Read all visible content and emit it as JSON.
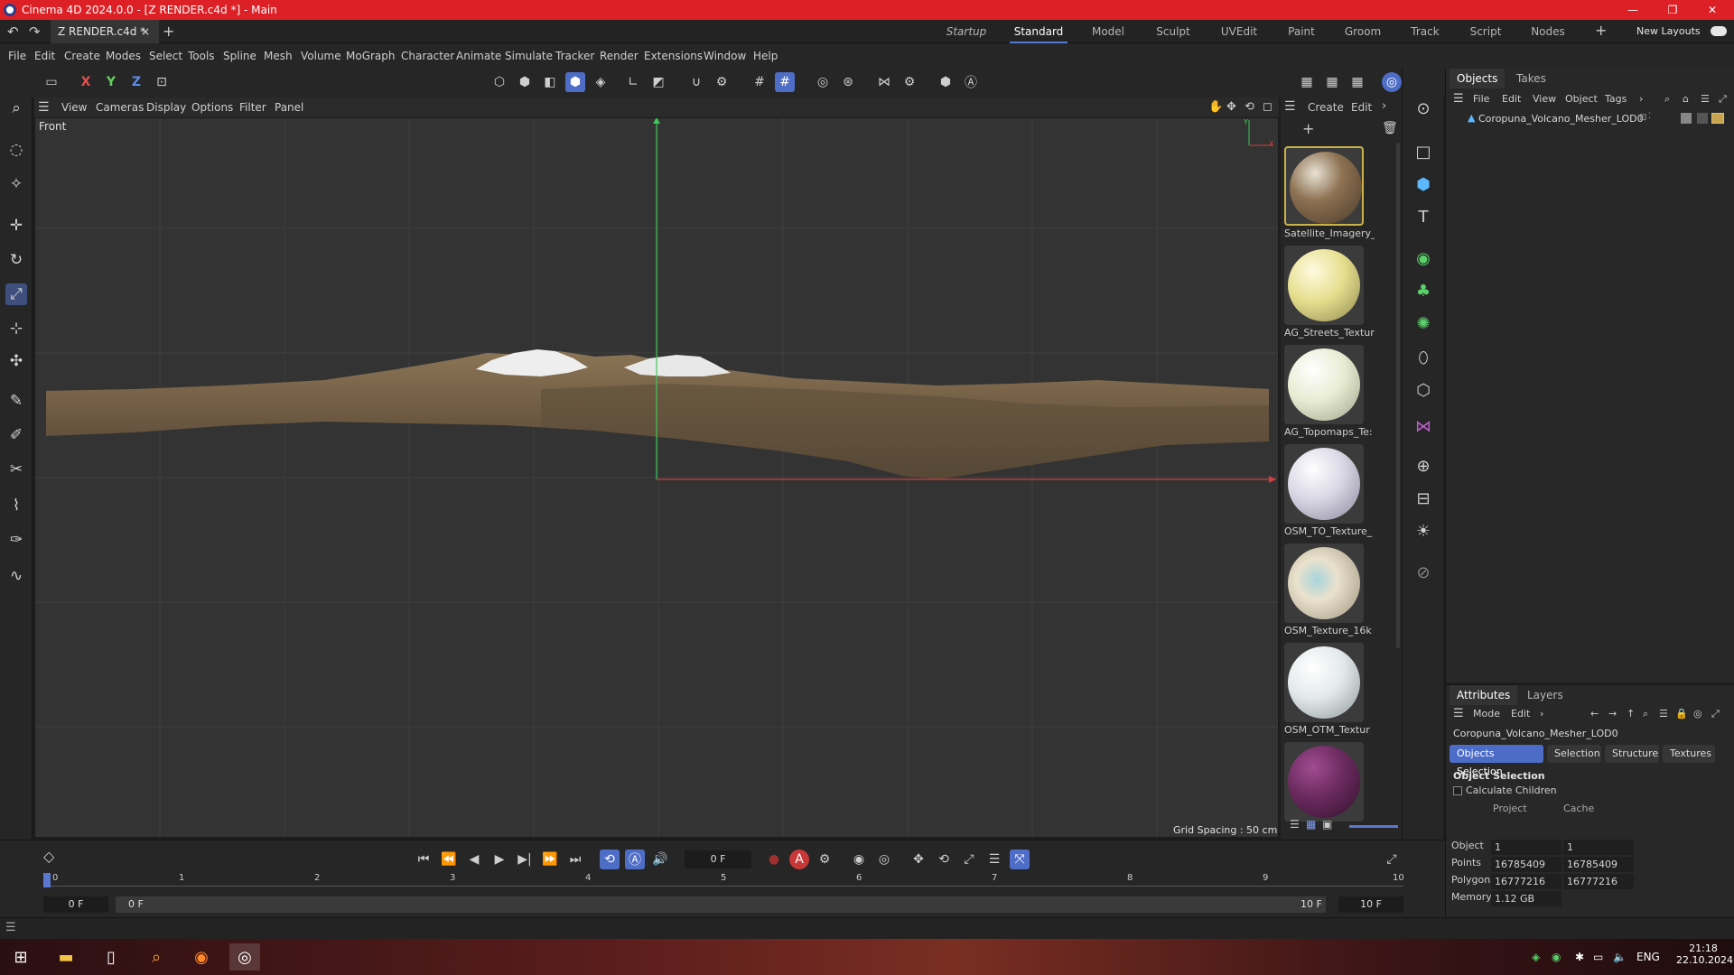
{
  "window": {
    "title": "Cinema 4D 2024.0.0 - [Z RENDER.c4d *] - Main"
  },
  "doc_tab": {
    "label": "Z RENDER.c4d *",
    "close": "×",
    "add": "+"
  },
  "layouts": {
    "items": [
      "Startup",
      "Standard",
      "Model",
      "Sculpt",
      "UVEdit",
      "Paint",
      "Groom",
      "Track",
      "Script",
      "Nodes"
    ],
    "new_layouts": "New Layouts"
  },
  "menu": [
    "File",
    "Edit",
    "Create",
    "Modes",
    "Select",
    "Tools",
    "Spline",
    "Mesh",
    "Volume",
    "MoGraph",
    "Character",
    "Animate",
    "Simulate",
    "Tracker",
    "Render",
    "Extensions",
    "Window",
    "Help"
  ],
  "axis_lock": {
    "x": "X",
    "y": "Y",
    "z": "Z"
  },
  "viewport": {
    "menu": [
      "View",
      "Cameras",
      "Display",
      "Options",
      "Filter",
      "Panel"
    ],
    "camera": "Front",
    "grid_spacing": "Grid Spacing : 50 cm",
    "axis_y": "Y",
    "axis_x": "X"
  },
  "materials": {
    "menu": [
      "Create",
      "Edit"
    ],
    "items": [
      {
        "name": "Satellite_Imagery_",
        "color": "#8d7152"
      },
      {
        "name": "AG_Streets_Textur",
        "color": "#e6de8e"
      },
      {
        "name": "AG_Topomaps_Te:",
        "color": "#e8ecd2"
      },
      {
        "name": "OSM_TO_Texture_",
        "color": "#d8d6e4"
      },
      {
        "name": "OSM_Texture_16k",
        "color": "#eae2cc"
      },
      {
        "name": "OSM_OTM_Textur",
        "color": "#e2e8ea"
      },
      {
        "name": "",
        "color": "#6a2a5e"
      }
    ]
  },
  "objects_panel": {
    "tabs": [
      "Objects",
      "Takes"
    ],
    "menu": [
      "File",
      "Edit",
      "View",
      "Object",
      "Tags"
    ],
    "object_name": "Coropuna_Volcano_Mesher_LOD0"
  },
  "attributes_panel": {
    "tabs": [
      "Attributes",
      "Layers"
    ],
    "menu": [
      "Mode",
      "Edit"
    ],
    "object_name": "Coropuna_Volcano_Mesher_LOD0",
    "sub_tabs": [
      "Objects Selection",
      "Selection",
      "Structure",
      "Textures"
    ],
    "section": "Object Selection",
    "checkbox": "Calculate Children",
    "col_project": "Project",
    "col_cache": "Cache",
    "rows": [
      {
        "label": "Object",
        "project": "1",
        "cache": "1"
      },
      {
        "label": "Points",
        "project": "16785409",
        "cache": "16785409"
      },
      {
        "label": "Polygons",
        "project": "16777216",
        "cache": "16777216"
      },
      {
        "label": "Memory",
        "project": "1.12 GB",
        "cache": ""
      }
    ]
  },
  "timeline": {
    "current_frame": "0 F",
    "ruler": [
      "0",
      "1",
      "2",
      "3",
      "4",
      "5",
      "6",
      "7",
      "8",
      "9",
      "10"
    ],
    "start": "0 F",
    "min": "0 F",
    "max": "10 F",
    "end": "10 F"
  },
  "taskbar": {
    "lang": "ENG",
    "time": "21:18",
    "date": "22.10.2024"
  },
  "colors": {
    "titlebar": "#dd2026",
    "accent": "#4e6dc6",
    "axis_y": "#3ec75a",
    "axis_x": "#d23c3c"
  }
}
